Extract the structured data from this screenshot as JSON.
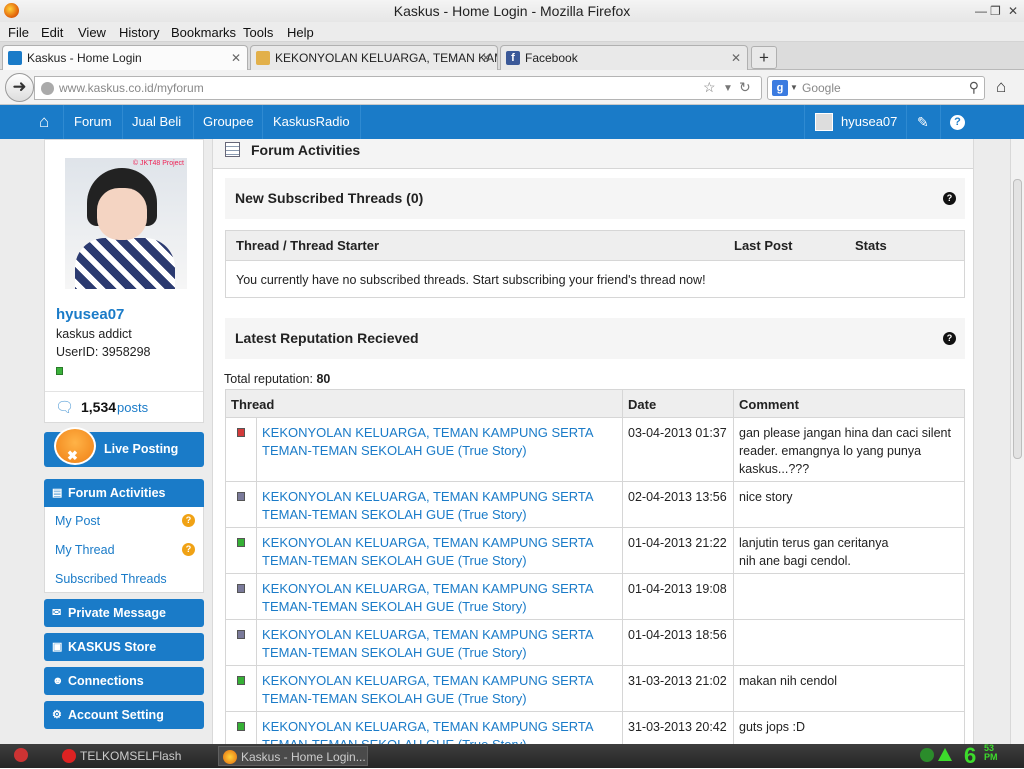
{
  "window": {
    "title": "Kaskus - Home Login - Mozilla Firefox"
  },
  "menu": [
    "File",
    "Edit",
    "View",
    "History",
    "Bookmarks",
    "Tools",
    "Help"
  ],
  "tabs": [
    {
      "label": "Kaskus - Home Login",
      "active": true,
      "icon": "kaskus-icon"
    },
    {
      "label": "KEKONYOLAN KELUARGA, TEMAN KAM...",
      "active": false,
      "icon": "kaskus-icon"
    },
    {
      "label": "Facebook",
      "active": false,
      "icon": "facebook-icon"
    }
  ],
  "urlbar": {
    "host": "www.kaskus.co.id",
    "path": "/myforum"
  },
  "search": {
    "engine": "Google",
    "placeholder": "Google"
  },
  "sitenav": {
    "items": [
      "Forum",
      "Jual Beli",
      "Groupee",
      "KaskusRadio"
    ],
    "user": "hyusea07"
  },
  "profile": {
    "watermark": "© JKT48 Project",
    "username": "hyusea07",
    "rank": "kaskus addict",
    "userid": "UserID: 3958298",
    "posts_count": "1,534",
    "posts_label": "posts"
  },
  "sidebar": {
    "live_posting": "Live Posting",
    "forum_activities": "Forum Activities",
    "submenu": [
      "My Post",
      "My Thread",
      "Subscribed Threads"
    ],
    "private_message": "Private Message",
    "store": "KASKUS Store",
    "connections": "Connections",
    "account_setting": "Account Setting"
  },
  "main": {
    "title": "Forum Activities",
    "subscribed": {
      "title": "New Subscribed Threads (0)",
      "columns": [
        "Thread / Thread Starter",
        "Last Post",
        "Stats"
      ],
      "empty_message": "You currently have no subscribed threads. Start subscribing your friend's thread now!"
    },
    "reputation": {
      "title": "Latest Reputation Recieved",
      "total_label": "Total reputation:",
      "total_value": "80",
      "columns": [
        "Thread",
        "Date",
        "Comment"
      ],
      "rows": [
        {
          "color": "#d23a3a",
          "thread": "KEKONYOLAN KELUARGA, TEMAN KAMPUNG SERTA TEMAN-TEMAN SEKOLAH GUE (True Story)",
          "date": "03-04-2013 01:37",
          "comment": "gan please jangan hina dan caci silent reader. emangnya lo yang punya kaskus...???"
        },
        {
          "color": "#7a7a9a",
          "thread": "KEKONYOLAN KELUARGA, TEMAN KAMPUNG SERTA TEMAN-TEMAN SEKOLAH GUE (True Story)",
          "date": "02-04-2013 13:56",
          "comment": "nice story"
        },
        {
          "color": "#35b035",
          "thread": "KEKONYOLAN KELUARGA, TEMAN KAMPUNG SERTA TEMAN-TEMAN SEKOLAH GUE (True Story)",
          "date": "01-04-2013 21:22",
          "comment": "lanjutin terus gan ceritanya\nnih ane bagi cendol."
        },
        {
          "color": "#7a7a9a",
          "thread": "KEKONYOLAN KELUARGA, TEMAN KAMPUNG SERTA TEMAN-TEMAN SEKOLAH GUE (True Story)",
          "date": "01-04-2013 19:08",
          "comment": ""
        },
        {
          "color": "#7a7a9a",
          "thread": "KEKONYOLAN KELUARGA, TEMAN KAMPUNG SERTA TEMAN-TEMAN SEKOLAH GUE (True Story)",
          "date": "01-04-2013 18:56",
          "comment": ""
        },
        {
          "color": "#35b035",
          "thread": "KEKONYOLAN KELUARGA, TEMAN KAMPUNG SERTA TEMAN-TEMAN SEKOLAH GUE (True Story)",
          "date": "31-03-2013 21:02",
          "comment": "makan nih cendol"
        },
        {
          "color": "#35b035",
          "thread": "KEKONYOLAN KELUARGA, TEMAN KAMPUNG SERTA TEMAN-TEMAN SEKOLAH GUE (True Story)",
          "date": "31-03-2013 20:42",
          "comment": "guts jops :D"
        }
      ]
    }
  },
  "taskbar": {
    "items": [
      "TELKOMSELFlash",
      "Kaskus - Home Login..."
    ],
    "clock_hour": "6",
    "clock_min": "53",
    "clock_ampm": "PM"
  }
}
